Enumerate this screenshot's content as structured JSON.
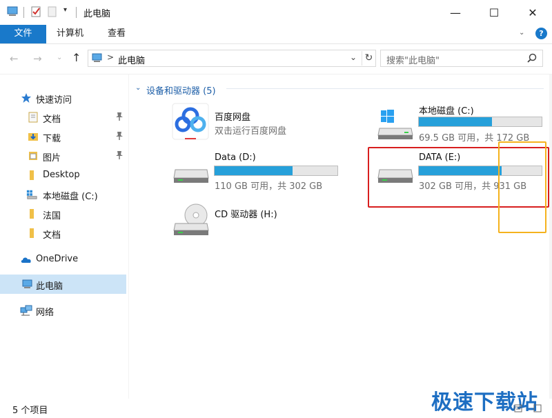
{
  "window": {
    "title": "此电脑",
    "minimize": "—",
    "maximize": "☐",
    "close": "✕",
    "qa_dropdown": "▾"
  },
  "ribbon": {
    "tabs": [
      "文件",
      "计算机",
      "查看"
    ],
    "expand": "⌄",
    "help": "?"
  },
  "address": {
    "back": "←",
    "forward": "→",
    "recent": "⌄",
    "up": "↑",
    "chevron": ">",
    "path": "此电脑",
    "dropdown": "⌄",
    "refresh": "↻",
    "search_placeholder": "搜索\"此电脑\""
  },
  "sidebar": {
    "items": [
      {
        "label": "快速访问",
        "icon": "star-icon",
        "pinned": false
      },
      {
        "label": "文档",
        "icon": "documents-folder-icon",
        "pinned": true
      },
      {
        "label": "下载",
        "icon": "downloads-folder-icon",
        "pinned": true
      },
      {
        "label": "图片",
        "icon": "pictures-folder-icon",
        "pinned": true
      },
      {
        "label": "Desktop",
        "icon": "folder-icon",
        "pinned": false
      },
      {
        "label": "本地磁盘 (C:)",
        "icon": "windows-drive-icon",
        "pinned": false
      },
      {
        "label": "法国",
        "icon": "folder-icon",
        "pinned": false
      },
      {
        "label": "文档",
        "icon": "folder-icon",
        "pinned": false
      },
      {
        "label": "OneDrive",
        "icon": "cloud-icon",
        "pinned": false
      },
      {
        "label": "此电脑",
        "icon": "pc-icon",
        "pinned": false,
        "selected": true
      },
      {
        "label": "网络",
        "icon": "network-icon",
        "pinned": false
      }
    ]
  },
  "content": {
    "group_chevron": "⌄",
    "group_title": "设备和驱动器 (5)",
    "drives": [
      {
        "name": "百度网盘",
        "sub": "双击运行百度网盘",
        "icon": "baidu-netdisk-icon"
      },
      {
        "name": "本地磁盘 (C:)",
        "sub": "69.5 GB 可用，共 172 GB",
        "used_fraction": 0.596,
        "icon": "windows-drive-icon"
      },
      {
        "name": "Data (D:)",
        "sub": "110 GB 可用，共 302 GB",
        "used_fraction": 0.636,
        "icon": "hard-drive-icon"
      },
      {
        "name": "DATA (E:)",
        "sub": "302 GB 可用，共 931 GB",
        "used_fraction": 0.676,
        "icon": "hard-drive-icon"
      },
      {
        "name": "CD 驱动器 (H:)",
        "icon": "cd-drive-icon"
      }
    ]
  },
  "status": {
    "items_count": "5 个项目",
    "watermark": "极速下载站"
  },
  "colors": {
    "accent": "#1979ca",
    "bar_fill": "#26a0da",
    "highlight_red": "#d81e1e",
    "highlight_yellow": "#f5b21d"
  }
}
